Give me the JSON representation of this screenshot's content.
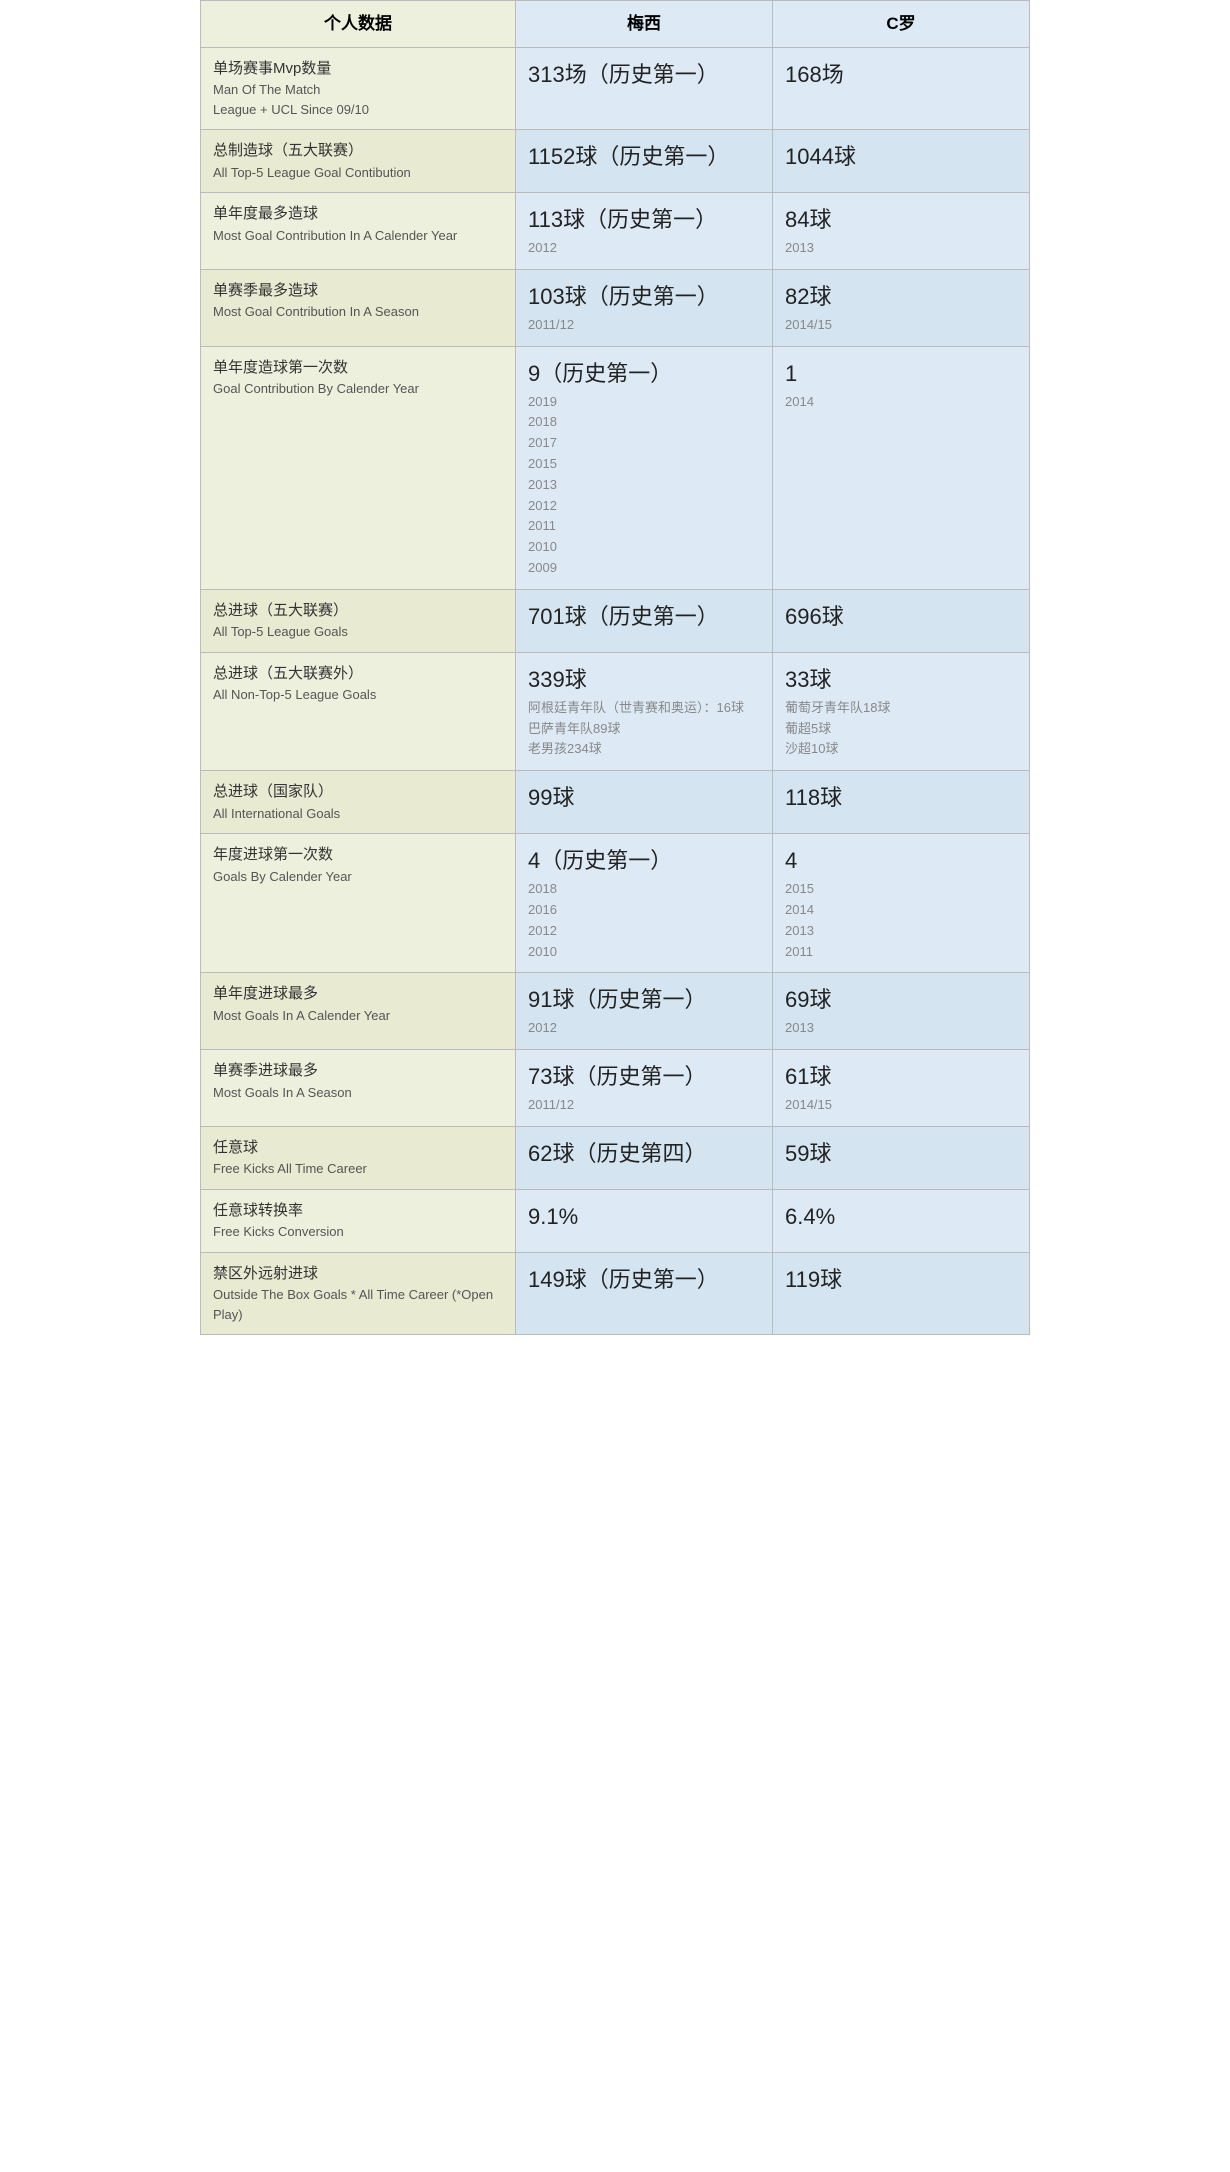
{
  "header": {
    "col_label": "个人数据",
    "col_messi": "梅西",
    "col_ronaldo": "C罗"
  },
  "rows": [
    {
      "label_zh": "单场赛事Mvp数量",
      "label_en": "Man Of The Match\nLeague + UCL Since 09/10",
      "messi_main": "313场（历史第一）",
      "messi_sub": "",
      "ronaldo_main": "168场",
      "ronaldo_sub": ""
    },
    {
      "label_zh": "总制造球（五大联赛）",
      "label_en": "All Top-5 League Goal Contibution",
      "messi_main": "1152球（历史第一）",
      "messi_sub": "",
      "ronaldo_main": "1044球",
      "ronaldo_sub": ""
    },
    {
      "label_zh": "单年度最多造球",
      "label_en": "Most Goal Contribution In A Calender Year",
      "messi_main": "113球（历史第一）",
      "messi_sub": "2012",
      "ronaldo_main": "84球",
      "ronaldo_sub": "2013"
    },
    {
      "label_zh": "单赛季最多造球",
      "label_en": "Most Goal Contribution In A Season",
      "messi_main": "103球（历史第一）",
      "messi_sub": "2011/12",
      "ronaldo_main": "82球",
      "ronaldo_sub": "2014/15"
    },
    {
      "label_zh": "单年度造球第一次数",
      "label_en": "Goal Contribution By Calender Year",
      "messi_main": "9（历史第一）",
      "messi_sub": "2019\n2018\n2017\n2015\n2013\n2012\n2011\n2010\n2009",
      "ronaldo_main": "1",
      "ronaldo_sub": "2014"
    },
    {
      "label_zh": "总进球（五大联赛）",
      "label_en": "All Top-5 League Goals",
      "messi_main": "701球（历史第一）",
      "messi_sub": "",
      "ronaldo_main": "696球",
      "ronaldo_sub": ""
    },
    {
      "label_zh": "总进球（五大联赛外）",
      "label_en": "All Non-Top-5 League Goals",
      "messi_main": "339球",
      "messi_sub": "阿根廷青年队（世青赛和奥运）：16球\n巴萨青年队89球\n老男孩234球",
      "ronaldo_main": "33球",
      "ronaldo_sub": "葡萄牙青年队18球\n葡超5球\n沙超10球"
    },
    {
      "label_zh": "总进球（国家队）",
      "label_en": "All International Goals",
      "messi_main": "99球",
      "messi_sub": "",
      "ronaldo_main": "118球",
      "ronaldo_sub": ""
    },
    {
      "label_zh": "年度进球第一次数",
      "label_en": "Goals By Calender Year",
      "messi_main": "4（历史第一）",
      "messi_sub": "2018\n2016\n2012\n2010",
      "ronaldo_main": "4",
      "ronaldo_sub": "2015\n2014\n2013\n2011"
    },
    {
      "label_zh": "单年度进球最多",
      "label_en": "Most Goals In A Calender Year",
      "messi_main": "91球（历史第一）",
      "messi_sub": "2012",
      "ronaldo_main": "69球",
      "ronaldo_sub": "2013"
    },
    {
      "label_zh": "单赛季进球最多",
      "label_en": "Most Goals In A Season",
      "messi_main": "73球（历史第一）",
      "messi_sub": "2011/12",
      "ronaldo_main": "61球",
      "ronaldo_sub": "2014/15"
    },
    {
      "label_zh": "任意球",
      "label_en": "Free Kicks All Time Career",
      "messi_main": "62球（历史第四）",
      "messi_sub": "",
      "ronaldo_main": "59球",
      "ronaldo_sub": ""
    },
    {
      "label_zh": "任意球转换率",
      "label_en": "Free Kicks Conversion",
      "messi_main": "9.1%",
      "messi_sub": "",
      "ronaldo_main": "6.4%",
      "ronaldo_sub": ""
    },
    {
      "label_zh": "禁区外远射进球",
      "label_en": "Outside The Box Goals * All Time Career (*Open Play)",
      "messi_main": "149球（历史第一）",
      "messi_sub": "",
      "ronaldo_main": "119球",
      "ronaldo_sub": ""
    }
  ]
}
